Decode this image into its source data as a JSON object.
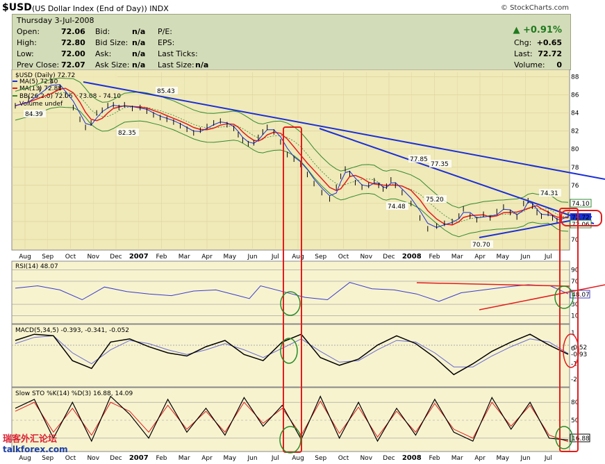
{
  "header": {
    "symbol": "$USD",
    "name": "(US Dollar Index (End of Day))",
    "exchange": "INDX",
    "brand": "© StockCharts.com"
  },
  "quote": {
    "date": "Thursday   3-Jul-2008",
    "open_label": "Open:",
    "open": "72.06",
    "high_label": "High:",
    "high": "72.80",
    "low_label": "Low:",
    "low": "72.00",
    "prev_label": "Prev Close:",
    "prev": "72.07",
    "bid_label": "Bid:",
    "bid": "n/a",
    "bidsize_label": "Bid Size:",
    "bidsize": "n/a",
    "ask_label": "Ask:",
    "ask": "n/a",
    "asksize_label": "Ask Size:",
    "asksize": "n/a",
    "pe_label": "P/E:",
    "eps_label": "EPS:",
    "lastticks_label": "Last Ticks:",
    "lastsize_label": "Last Size:",
    "lastsize": "n/a",
    "change_pct": "▲ +0.91%",
    "chg_label": "Chg:",
    "chg": "+0.65",
    "last_label": "Last:",
    "last": "72.72",
    "volume_label": "Volume:",
    "volume": "0"
  },
  "colors": {
    "panel_bg": "#f7f3cf",
    "price_bg": "#f0e9b8",
    "trendline": "#1a2fd6",
    "annotation": "#e31b1b",
    "ma5": "#1a2fd6",
    "ma13": "#e31b1b",
    "bollinger": "#2f8a2f",
    "circle": "#2a8a2a"
  },
  "watermark": {
    "line1": "瑞客外汇论坛",
    "line2": "talkforex.com"
  },
  "chart_data": [
    {
      "type": "line",
      "title": "$USD (Daily) 72.72",
      "legend": [
        "$USD (Daily) 72.72",
        "MA(5) 72.40",
        "MA(13) 72.88",
        "BB(26,2.0) 72.06 - 73.08 - 74.10",
        "Volume undef"
      ],
      "x_ticks": [
        "Aug",
        "Sep",
        "Oct",
        "Nov",
        "Dec",
        "2007",
        "Feb",
        "Mar",
        "Apr",
        "May",
        "Jun",
        "Jul",
        "Aug",
        "Sep",
        "Oct",
        "Nov",
        "Dec",
        "2008",
        "Feb",
        "Mar",
        "Apr",
        "May",
        "Jun",
        "Jul"
      ],
      "y_ticks": [
        70,
        72,
        74,
        76,
        78,
        80,
        82,
        84,
        86,
        88
      ],
      "ylim": [
        69,
        88.5
      ],
      "x": [
        0,
        12,
        22,
        32,
        40,
        45,
        52,
        58,
        63,
        68,
        73,
        78,
        83,
        88,
        93,
        98,
        105,
        112,
        118,
        124,
        130,
        136,
        142,
        148,
        154,
        160,
        166,
        172,
        178,
        184,
        190,
        196,
        200,
        204,
        209,
        214,
        218,
        222,
        226,
        232,
        238,
        244,
        250,
        256,
        262,
        268,
        275,
        282,
        288,
        292,
        296,
        300,
        305,
        311,
        317,
        322,
        326,
        330,
        333,
        337,
        341,
        347,
        355,
        363,
        370,
        378,
        385,
        392,
        398,
        402,
        408,
        414,
        420,
        426,
        432,
        438,
        444,
        450,
        456,
        460,
        464,
        468,
        472,
        478,
        482,
        486,
        490,
        496
      ],
      "values": [
        84.8,
        85.6,
        86.6,
        87.5,
        86.8,
        86.0,
        84.6,
        83.3,
        82.4,
        82.9,
        84.0,
        84.3,
        84.8,
        84.9,
        84.6,
        84.9,
        84.5,
        84.6,
        84.2,
        83.8,
        83.5,
        83.3,
        83.0,
        82.6,
        82.2,
        81.8,
        82.1,
        82.5,
        82.9,
        83.1,
        82.7,
        82.3,
        81.6,
        81.0,
        80.6,
        80.7,
        81.3,
        81.9,
        82.4,
        81.9,
        80.8,
        79.4,
        78.9,
        78.3,
        77.2,
        76.2,
        75.2,
        74.5,
        75.8,
        77.0,
        77.8,
        77.3,
        76.3,
        75.8,
        76.0,
        76.5,
        76.0,
        75.6,
        75.9,
        76.6,
        76.0,
        75.2,
        74.0,
        72.4,
        71.2,
        71.5,
        71.8,
        72.0,
        72.6,
        73.4,
        72.6,
        72.2,
        72.8,
        72.4,
        73.1,
        73.6,
        73.0,
        72.5,
        74.0,
        74.3,
        73.7,
        73.0,
        72.6,
        72.9,
        72.4,
        72.1,
        72.4,
        72.72
      ],
      "annotations": [
        "84.39",
        "85.43",
        "82.35",
        "77.85",
        "77.35",
        "74.48",
        "75.20",
        "70.70",
        "74.31"
      ],
      "price_labels": [
        "74.10",
        "72.72",
        "72.06"
      ]
    },
    {
      "type": "line",
      "title": "RSI(14) 48.07",
      "y_ticks": [
        10,
        30,
        70,
        90
      ],
      "ylim": [
        0,
        100
      ],
      "x": [
        0,
        20,
        40,
        60,
        80,
        100,
        120,
        140,
        160,
        180,
        200,
        210,
        220,
        240,
        260,
        280,
        300,
        320,
        340,
        360,
        380,
        400,
        420,
        440,
        460,
        480,
        496
      ],
      "values": [
        58,
        62,
        55,
        38,
        60,
        52,
        48,
        45,
        53,
        55,
        45,
        40,
        62,
        52,
        42,
        38,
        68,
        57,
        55,
        48,
        35,
        50,
        55,
        60,
        64,
        62,
        48.07
      ],
      "value_label": "48.07"
    },
    {
      "type": "line",
      "title": "MACD(5,34,5) -0.393, -0.341, -0.052",
      "series": [
        {
          "name": "MACD",
          "values": [
            0.5,
            0.9,
            0.8,
            -0.8,
            -1.3,
            0.4,
            0.6,
            0.1,
            -0.3,
            -0.5,
            0.1,
            0.5,
            -0.4,
            -0.8,
            0.4,
            0.9,
            -0.6,
            -1.1,
            -0.7,
            0.2,
            0.8,
            0.3,
            -0.6,
            -1.7,
            -1.0,
            -0.2,
            0.4,
            0.9,
            0.2,
            -0.393
          ]
        },
        {
          "name": "Signal",
          "values": [
            0.3,
            0.7,
            0.8,
            -0.3,
            -1.0,
            -0.1,
            0.5,
            0.3,
            -0.1,
            -0.4,
            -0.1,
            0.3,
            -0.1,
            -0.6,
            0.0,
            0.6,
            -0.2,
            -0.9,
            -0.8,
            -0.1,
            0.5,
            0.4,
            -0.3,
            -1.2,
            -1.2,
            -0.5,
            0.1,
            0.6,
            0.4,
            -0.341
          ]
        }
      ],
      "y_ticks": [
        -2,
        -1,
        0,
        1
      ],
      "ylim": [
        -2.4,
        1.4
      ],
      "value_labels": [
        "-0.52",
        "-0.93"
      ]
    },
    {
      "type": "line",
      "title": "Slow STO %K(14) %D(3) 16.88, 14.09",
      "series": [
        {
          "name": "%K",
          "values": [
            70,
            85,
            20,
            80,
            15,
            90,
            60,
            20,
            85,
            30,
            70,
            25,
            88,
            40,
            75,
            18,
            90,
            20,
            80,
            15,
            70,
            25,
            85,
            30,
            15,
            88,
            35,
            80,
            20,
            16.88
          ]
        },
        {
          "name": "%D",
          "values": [
            65,
            80,
            30,
            70,
            25,
            80,
            65,
            30,
            75,
            35,
            65,
            30,
            80,
            45,
            70,
            25,
            82,
            28,
            72,
            22,
            65,
            30,
            78,
            35,
            20,
            80,
            40,
            75,
            25,
            14.09
          ]
        }
      ],
      "y_ticks": [
        20,
        50,
        80
      ],
      "ylim": [
        0,
        100
      ],
      "value_label": "16.88"
    }
  ]
}
